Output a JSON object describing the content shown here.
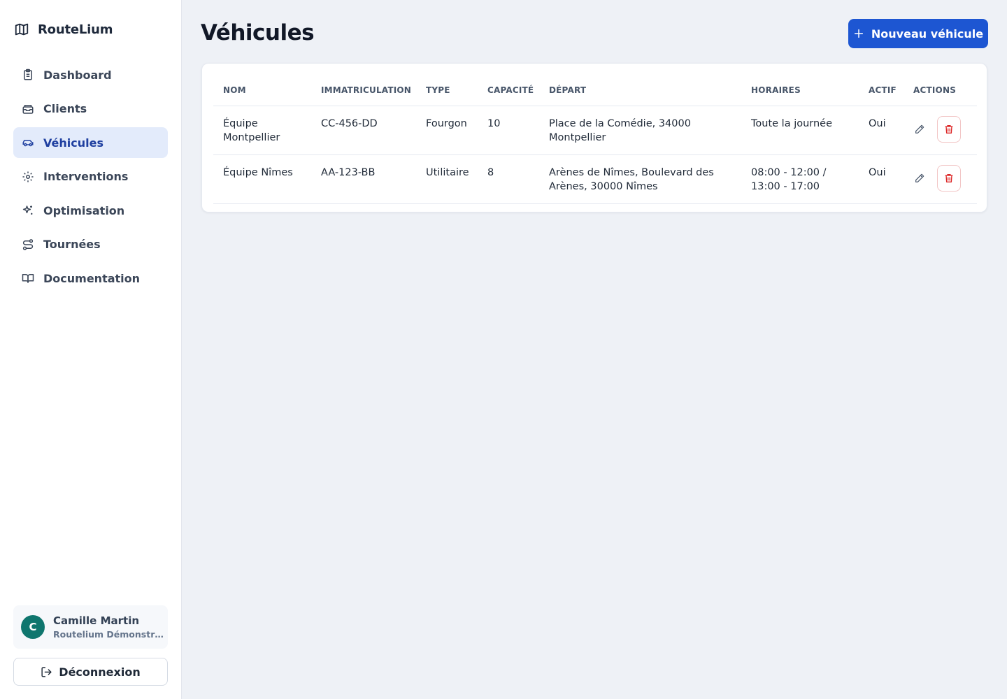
{
  "app": {
    "name": "RouteLium",
    "logo_icon": "map-icon"
  },
  "sidebar": {
    "items": [
      {
        "label": "Dashboard",
        "icon": "clipboard-icon",
        "active": false
      },
      {
        "label": "Clients",
        "icon": "inbox-icon",
        "active": false
      },
      {
        "label": "Véhicules",
        "icon": "car-icon",
        "active": true
      },
      {
        "label": "Interventions",
        "icon": "gear-icon",
        "active": false
      },
      {
        "label": "Optimisation",
        "icon": "sparkles-icon",
        "active": false
      },
      {
        "label": "Tournées",
        "icon": "route-icon",
        "active": false
      },
      {
        "label": "Documentation",
        "icon": "book-icon",
        "active": false
      }
    ],
    "user": {
      "initial": "C",
      "name": "Camille Martin",
      "org": "Routelium Démonstration"
    },
    "logout_label": "Déconnexion"
  },
  "main": {
    "title": "Véhicules",
    "new_button_label": "Nouveau véhicule",
    "table": {
      "headers": [
        "Nom",
        "Immatriculation",
        "Type",
        "Capacité",
        "Départ",
        "Horaires",
        "Actif",
        "Actions"
      ],
      "rows": [
        {
          "nom": "Équipe Montpellier",
          "immatriculation": "CC-456-DD",
          "type": "Fourgon",
          "capacite": "10",
          "depart": "Place de la Comédie, 34000 Montpellier",
          "horaires": "Toute la journée",
          "actif": "Oui"
        },
        {
          "nom": "Équipe Nîmes",
          "immatriculation": "AA-123-BB",
          "type": "Utilitaire",
          "capacite": "8",
          "depart": "Arènes de Nîmes, Boulevard des Arènes, 30000 Nîmes",
          "horaires": "08:00 - 12:00 / 13:00 - 17:00",
          "actif": "Oui"
        }
      ]
    }
  },
  "colors": {
    "primary": "#1d56d2",
    "active_bg": "#e3ebfb",
    "danger": "#dc2626",
    "avatar": "#0f766e"
  }
}
